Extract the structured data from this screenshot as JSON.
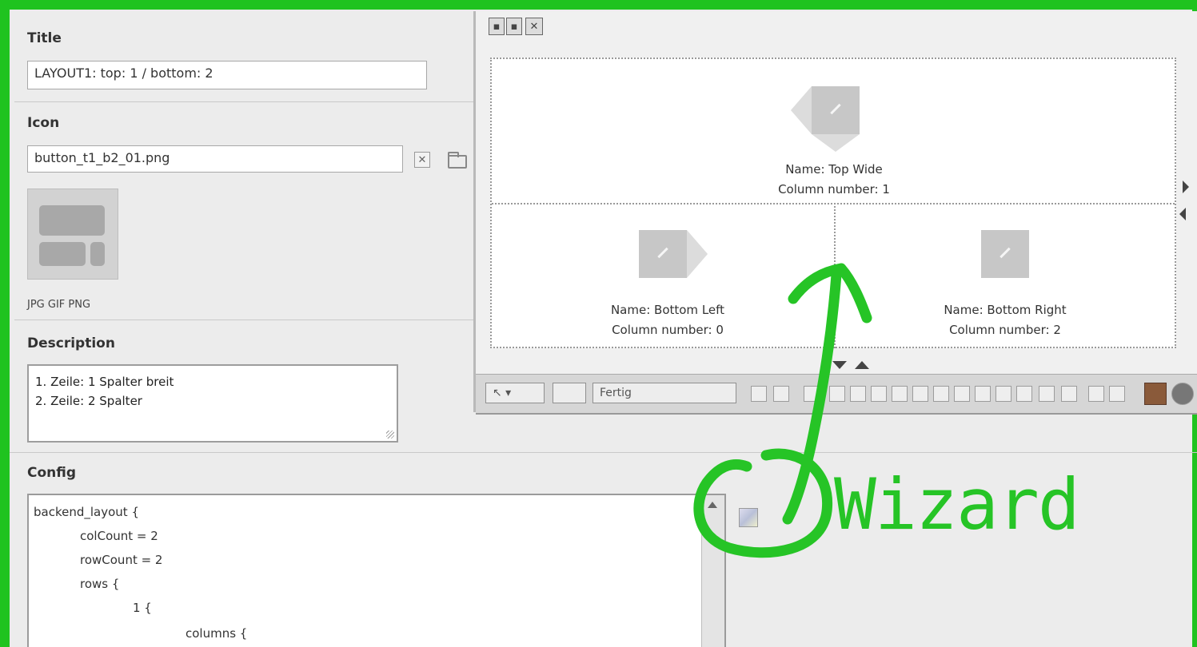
{
  "form": {
    "title_label": "Title",
    "title_value": "LAYOUT1: top: 1 / bottom: 2",
    "icon_label": "Icon",
    "icon_value": "button_t1_b2_01.png",
    "icon_formats": "JPG GIF PNG",
    "description_label": "Description",
    "description_lines": [
      "1. Zeile: 1 Spalter breit",
      "2. Zeile: 2 Spalter"
    ],
    "config_label": "Config",
    "config_lines": [
      "backend_layout {",
      "colCount = 2",
      "rowCount = 2",
      "rows {",
      "1 {",
      "columns {"
    ]
  },
  "wizard": {
    "cells": {
      "top": {
        "name": "Name: Top Wide",
        "column": "Column number: 1"
      },
      "bottom_left": {
        "name": "Name: Bottom Left",
        "column": "Column number: 0"
      },
      "bottom_right": {
        "name": "Name: Bottom Right",
        "column": "Column number: 2"
      }
    },
    "status_text": "Fertig"
  },
  "annotation": {
    "text": "Wizard",
    "color": "#26c426"
  },
  "colors": {
    "frame_border": "#1fc31f",
    "background": "#ececec"
  },
  "icons": [
    "save-icon",
    "save-close-icon",
    "close-icon",
    "clear-icon",
    "folder-icon",
    "pencil-icon",
    "wizard-icon"
  ]
}
